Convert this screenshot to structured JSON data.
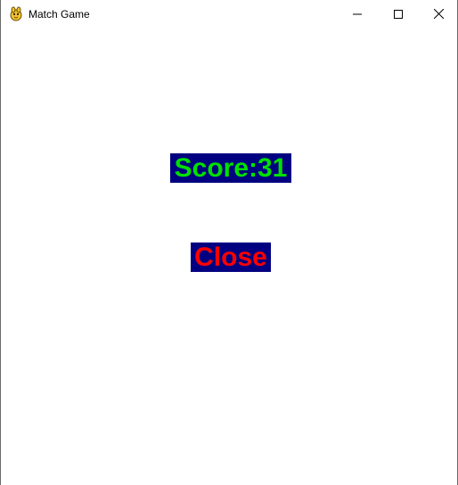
{
  "window": {
    "title": "Match Game",
    "icon": "pygame-snake-icon",
    "controls": {
      "minimize_icon": "minimize-icon",
      "maximize_icon": "maximize-icon",
      "close_icon": "close-icon"
    }
  },
  "game": {
    "score_text": "Score:31",
    "close_label": "Close",
    "colors": {
      "score_text": "#00e000",
      "close_text": "#ff0000",
      "label_background": "#000080",
      "canvas_background": "#ffffff"
    }
  }
}
